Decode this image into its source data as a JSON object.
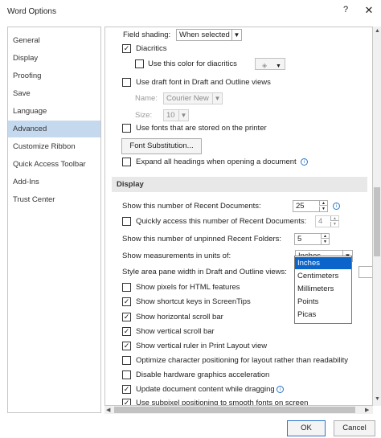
{
  "window": {
    "title": "Word Options",
    "help": "?",
    "close": "✕"
  },
  "nav": [
    "General",
    "Display",
    "Proofing",
    "Save",
    "Language",
    "Advanced",
    "Customize Ribbon",
    "Quick Access Toolbar",
    "Add-Ins",
    "Trust Center"
  ],
  "nav_selected": "Advanced",
  "options": {
    "field_shading_label": "Field shading:",
    "field_shading_value": "When selected",
    "diacritics": "Diacritics",
    "diacritics_color": "Use this color for diacritics",
    "draft_font": "Use draft font in Draft and Outline views",
    "name_label": "Name:",
    "name_value": "Courier New",
    "size_label": "Size:",
    "size_value": "10",
    "printer_fonts": "Use fonts that are stored on the printer",
    "font_substitution": "Font Substitution...",
    "expand_headings": "Expand all headings when opening a document"
  },
  "display": {
    "section_title": "Display",
    "recent_docs_label": "Show this number of Recent Documents:",
    "recent_docs_value": "25",
    "quick_access_label": "Quickly access this number of Recent Documents:",
    "quick_access_value": "4",
    "unpinned_label": "Show this number of unpinned Recent Folders:",
    "unpinned_value": "5",
    "measurements_label": "Show measurements in units of:",
    "measurements_value": "Inches",
    "style_area_label": "Style area pane width in Draft and Outline views:",
    "pixels_html": "Show pixels for HTML features",
    "shortcut_keys": "Show shortcut keys in ScreenTips",
    "horizontal_scroll": "Show horizontal scroll bar",
    "vertical_scroll": "Show vertical scroll bar",
    "vertical_ruler": "Show vertical ruler in Print Layout view",
    "optimize_char": "Optimize character positioning for layout rather than readability",
    "disable_hw": "Disable hardware graphics acceleration",
    "update_dragging": "Update document content while dragging",
    "subpixel": "Use subpixel positioning to smooth fonts on screen"
  },
  "units_dropdown": [
    "Inches",
    "Centimeters",
    "Millimeters",
    "Points",
    "Picas"
  ],
  "footer": {
    "ok": "OK",
    "cancel": "Cancel"
  },
  "colors": {
    "selected_nav": "#c5d9ee",
    "accent": "#0a64c9",
    "section_bg": "#e8e8e8"
  }
}
